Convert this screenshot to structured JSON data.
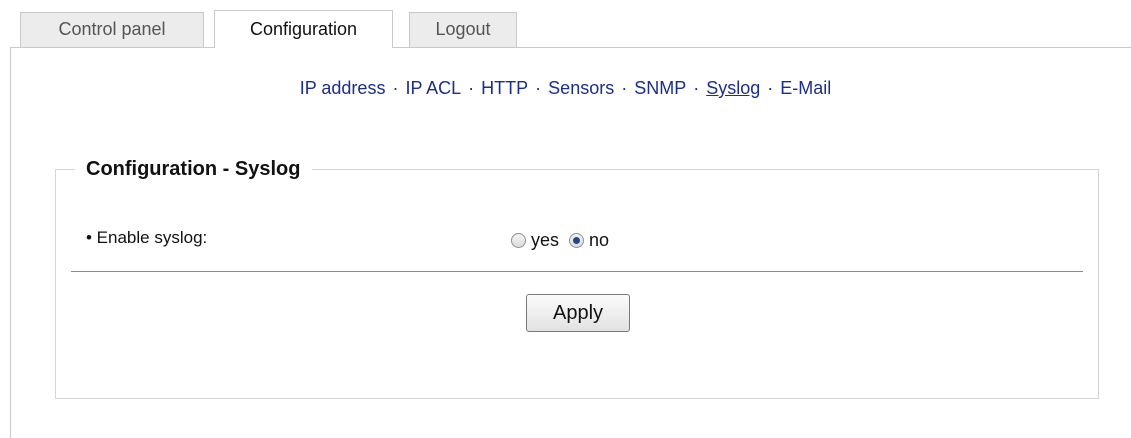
{
  "tabs": [
    {
      "label": "Control panel",
      "active": false
    },
    {
      "label": "Configuration",
      "active": true
    },
    {
      "label": "Logout",
      "active": false
    }
  ],
  "subnav": {
    "items": [
      {
        "label": "IP address"
      },
      {
        "label": "IP ACL"
      },
      {
        "label": "HTTP"
      },
      {
        "label": "Sensors"
      },
      {
        "label": "SNMP"
      },
      {
        "label": "Syslog",
        "current": true
      },
      {
        "label": "E-Mail"
      }
    ],
    "separator": "·"
  },
  "section": {
    "title": "Configuration - Syslog",
    "enable_label": "• Enable syslog:",
    "options": [
      {
        "label": "yes",
        "checked": false
      },
      {
        "label": "no",
        "checked": true
      }
    ],
    "apply_label": "Apply"
  },
  "colors": {
    "link": "#1a2e8c",
    "tab_inactive_bg": "#ececec",
    "border": "#c9c9c9"
  }
}
